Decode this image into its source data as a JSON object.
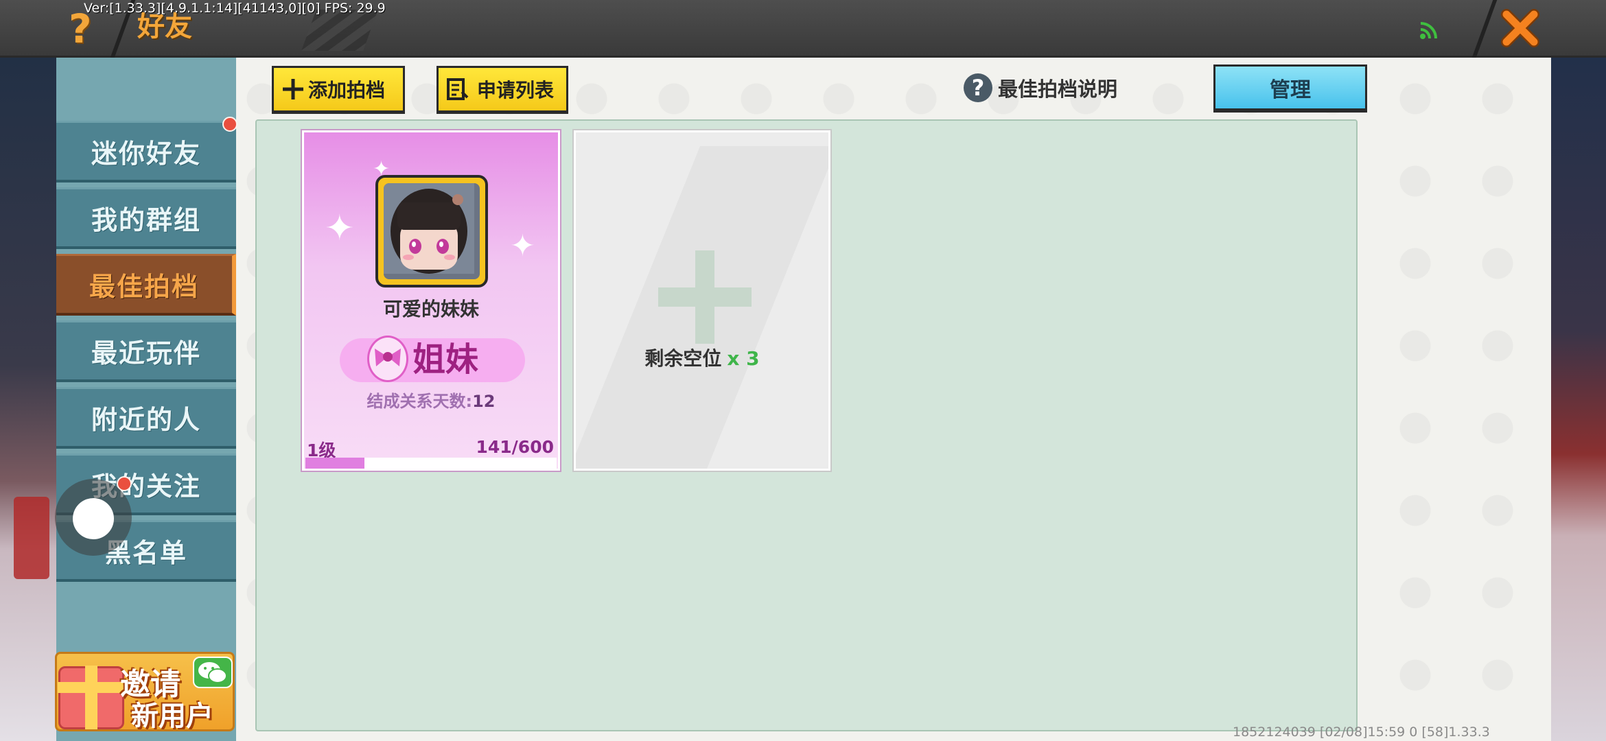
{
  "debug": {
    "text": "Ver:[1.33.3][4.9.1.1:14][41143,0][0] FPS: 29.9"
  },
  "header": {
    "title": "好友"
  },
  "sidebar": {
    "items": [
      {
        "label": "迷你好友"
      },
      {
        "label": "我的群组"
      },
      {
        "label": "最佳拍档"
      },
      {
        "label": "最近玩伴"
      },
      {
        "label": "附近的人"
      },
      {
        "label": "我的关注"
      },
      {
        "label": "黑名单"
      }
    ],
    "active_index": 2
  },
  "invite": {
    "line1": "邀请",
    "line2": "新用户"
  },
  "toolbar": {
    "add_partner": "添加拍档",
    "request_list": "申请列表",
    "help_link": "最佳拍档说明",
    "manage": "管理"
  },
  "partner": {
    "name": "可爱的妹妹",
    "relation": "姐妹",
    "days_label": "结成关系天数:",
    "days_value": "12",
    "level": "1级",
    "progress_text": "141/600",
    "progress_value": 141,
    "progress_max": 600
  },
  "empty_slot": {
    "label": "剩余空位",
    "count": "x 3"
  },
  "footer": {
    "text": "1852124039   [02/08]15:59 0   [58]1.33.3"
  },
  "colors": {
    "accent_orange": "#f3a63a",
    "tab_teal": "#4e8391",
    "tab_active": "#8a4f2a",
    "manage_blue": "#48c2ec",
    "yellow_button": "#f5c91a",
    "card_pink": "#e68ee6",
    "slot_green": "#3fb54a",
    "close_orange": "#f5821f",
    "signal_green": "#3fbf3f"
  }
}
